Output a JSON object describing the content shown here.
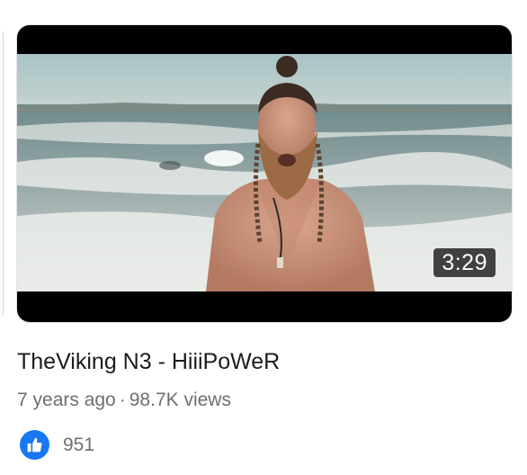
{
  "video": {
    "duration": "3:29",
    "title": "TheViking N3 - HiiiPoWeR",
    "age": "7 years ago",
    "separator": "·",
    "views": "98.7K views"
  },
  "reactions": {
    "icon": "thumbs-up-icon",
    "count": "951",
    "accent": "#1877f2"
  }
}
